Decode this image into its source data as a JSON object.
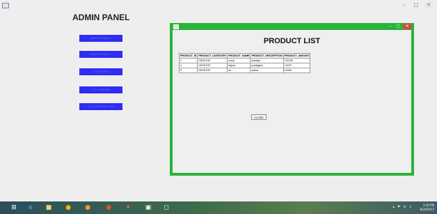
{
  "admin": {
    "title": "ADMIN PANEL",
    "menu_buttons": [
      "ADD PRODUCT",
      "EDIT PRODUCT",
      "LIST ORDER",
      "LIST VENDOR",
      "LIST VENDOR ITEM"
    ]
  },
  "product_window": {
    "title": "PRODUCT LIST",
    "columns": [
      "PRODUCT_ID",
      "PRODUCT_CATEGORY",
      "PRODUCT_NAME",
      "PRODUCT_DESCRIPTION",
      "PRODUCT_AMOUNT"
    ],
    "rows": [
      [
        "2",
        "DESKTOP",
        "comp",
        "jcdsklyk",
        "743766"
      ],
      [
        "4",
        "DESKTOP",
        "hdjshc",
        "jcdsklyjkm",
        "74379"
      ],
      [
        "5",
        "DESKTOP",
        "sd",
        "sadsd",
        "12000"
      ]
    ],
    "close_label": "CLOSE"
  },
  "taskbar": {
    "time": "3:30 PM",
    "date": "6/20/2017"
  },
  "colors": {
    "button": "#2f2cf5",
    "inner_frame": "#2bb23a",
    "close_red": "#e0433b"
  }
}
